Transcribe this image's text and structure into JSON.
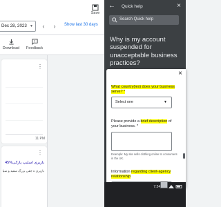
{
  "toolbar": {
    "date_range": "Dec 28, 2023",
    "show_last": "Show last 30 days",
    "save_label": "Save"
  },
  "actions": {
    "download_label": "Download",
    "feedback_label": "Feedback"
  },
  "chart": {
    "x_label": "11 PM"
  },
  "ad": {
    "title": "بازیری اسلیپ پارکی%45",
    "description": "بازیری ه جفی بزرگ سفید و سیاه"
  },
  "quick_help": {
    "title": "Quick help",
    "search_placeholder": "Search Quick help",
    "article_title": "Why is my account suspended for unacceptable business practices?"
  },
  "form": {
    "q1_label": "What country(ies) does your business serve? *",
    "q1_select_value": "Select one",
    "q2_prefix": "Please provide a ",
    "q2_highlight": "brief description",
    "q2_suffix": " of your business. *",
    "q2_hint": "Example: My site sells clothing online to consumers in the UK.",
    "q3_prefix": "Information ",
    "q3_highlight": "regarding client-agency relationship"
  },
  "status": {
    "clock": "7:24 PM"
  },
  "colors": {
    "accent": "#1a73e8",
    "highlight": "#ffff00",
    "panel_dark": "#3c4043"
  }
}
